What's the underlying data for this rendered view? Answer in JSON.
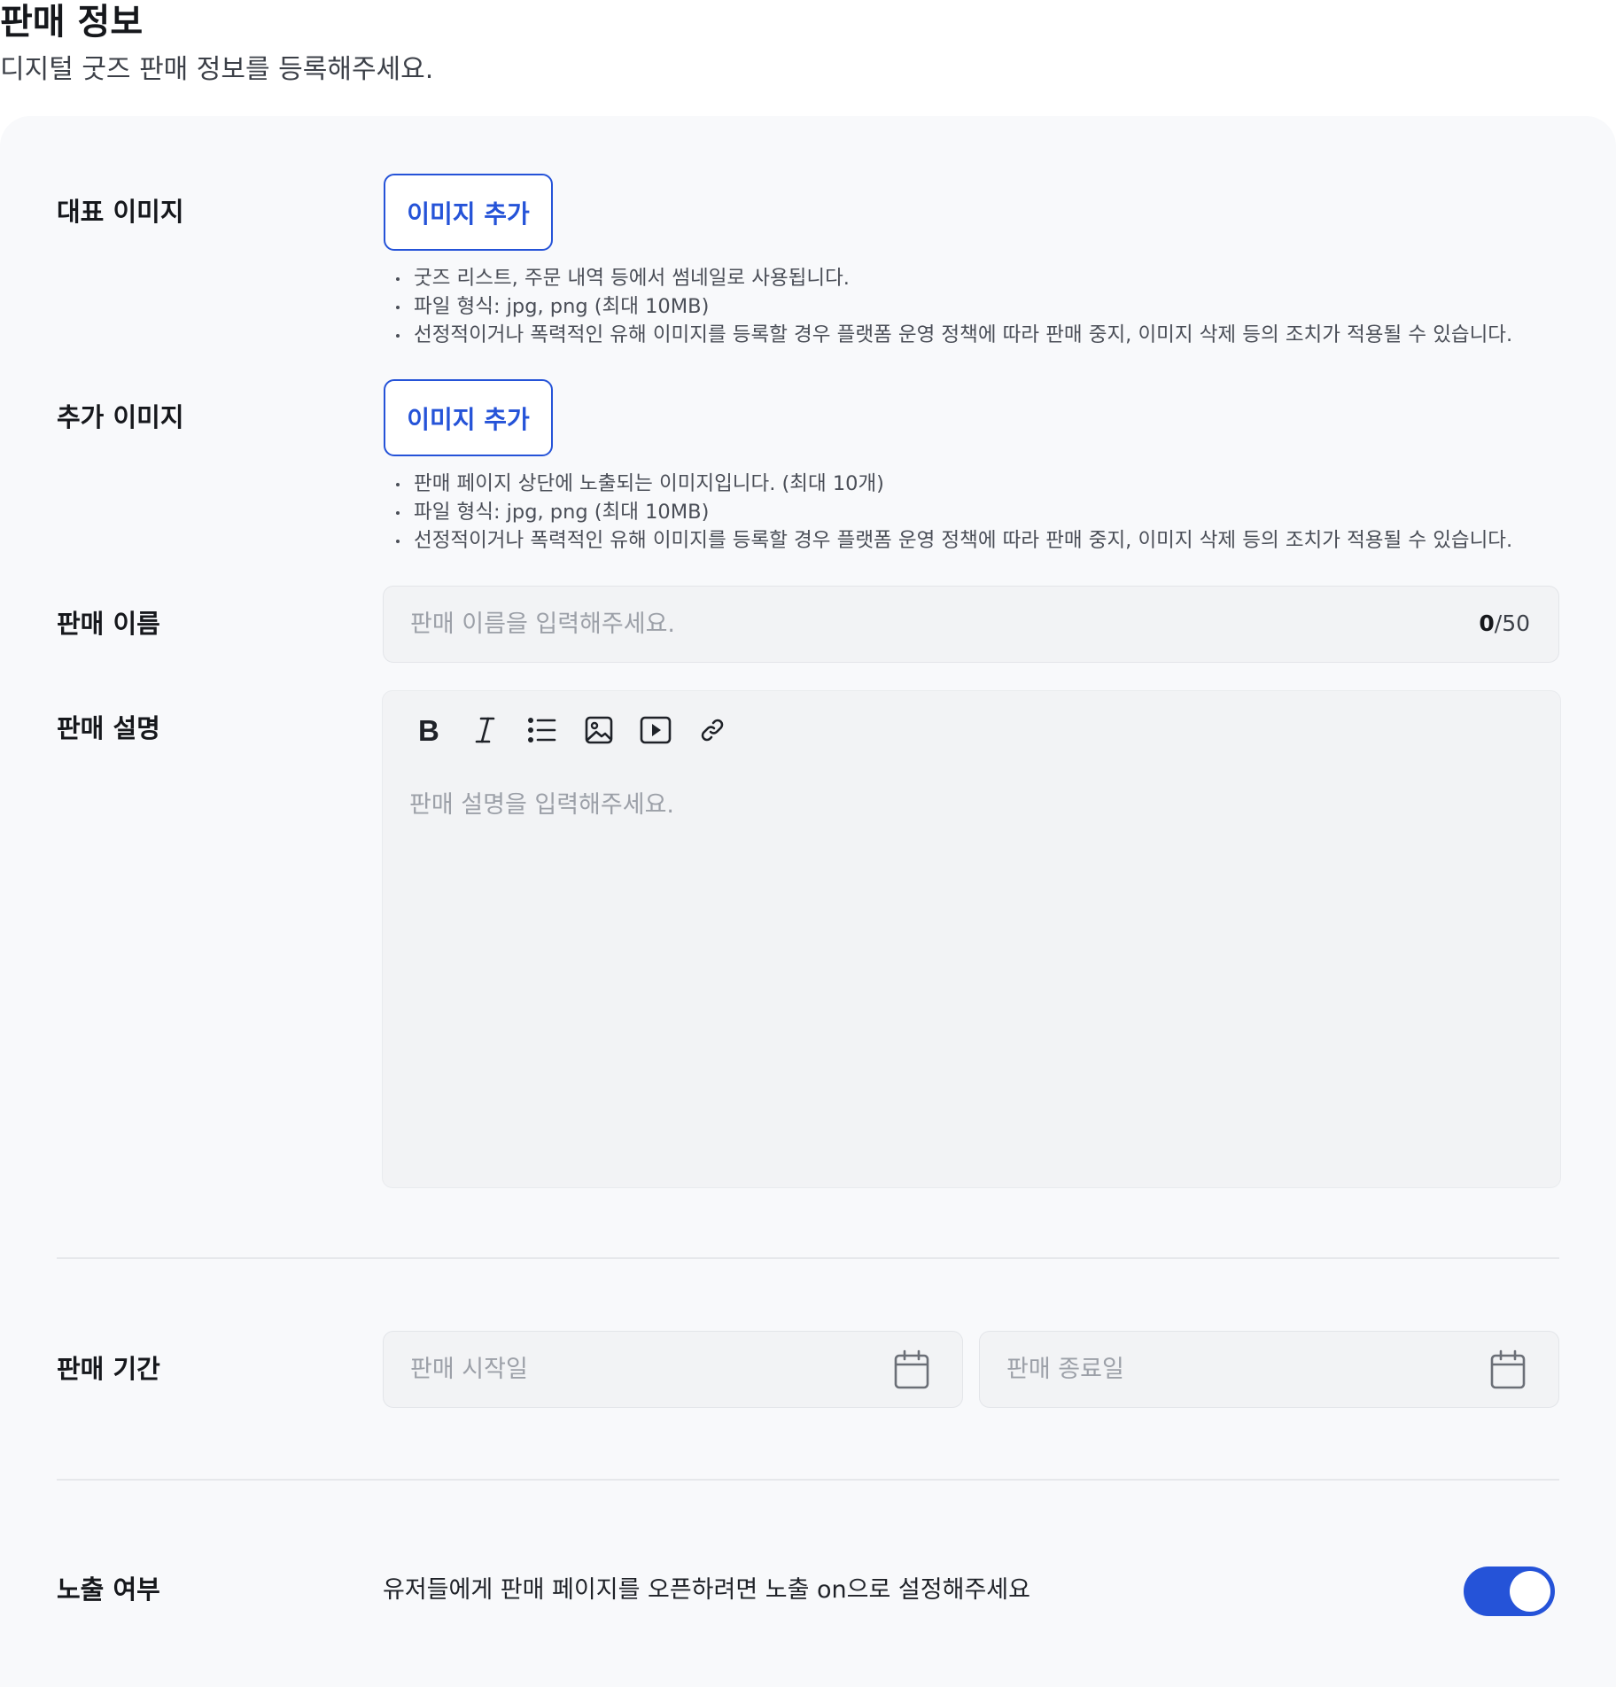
{
  "header": {
    "title": "판매 정보",
    "subtitle": "디지털 굿즈 판매 정보를 등록해주세요."
  },
  "main_image": {
    "label": "대표 이미지",
    "button_label": "이미지 추가",
    "notes": [
      "굿즈 리스트, 주문 내역 등에서 썸네일로 사용됩니다.",
      "파일 형식: jpg, png (최대 10MB)",
      "선정적이거나 폭력적인 유해 이미지를 등록할 경우 플랫폼 운영 정책에 따라 판매 중지, 이미지 삭제 등의 조치가 적용될 수 있습니다."
    ]
  },
  "extra_image": {
    "label": "추가 이미지",
    "button_label": "이미지 추가",
    "notes": [
      "판매 페이지 상단에 노출되는 이미지입니다. (최대 10개)",
      "파일 형식: jpg, png (최대 10MB)",
      "선정적이거나 폭력적인 유해 이미지를 등록할 경우 플랫폼 운영 정책에 따라 판매 중지, 이미지 삭제 등의 조치가 적용될 수 있습니다."
    ]
  },
  "sale_name": {
    "label": "판매 이름",
    "placeholder": "판매 이름을 입력해주세요.",
    "value": "",
    "count": "0",
    "max": "/50"
  },
  "sale_description": {
    "label": "판매 설명",
    "placeholder": "판매 설명을 입력해주세요.",
    "toolbar_icons": [
      "bold-icon",
      "italic-icon",
      "bulleted-list-icon",
      "image-icon",
      "video-icon",
      "link-icon"
    ]
  },
  "sale_period": {
    "label": "판매 기간",
    "start_placeholder": "판매 시작일",
    "end_placeholder": "판매 종료일",
    "icon": "calendar-icon"
  },
  "exposure": {
    "label": "노출 여부",
    "description": "유저들에게 판매 페이지를 오픈하려면 노출 on으로 설정해주세요",
    "enabled": true
  },
  "colors": {
    "accent": "#2553d8",
    "card_background": "#f8f9fb",
    "input_background": "#f2f3f5",
    "placeholder": "#9ca0a8"
  }
}
